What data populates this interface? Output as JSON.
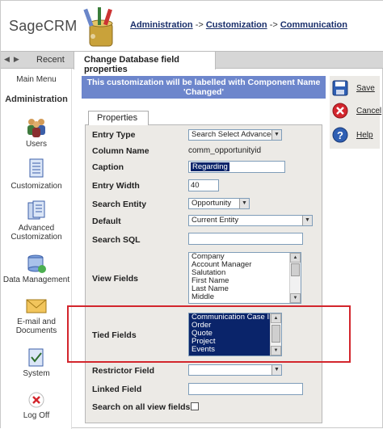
{
  "header": {
    "brand": "SageCRM",
    "breadcrumb": [
      "Administration",
      "Customization",
      "Communication"
    ],
    "separator": "->"
  },
  "tabs": {
    "recent": "Recent",
    "active": "Change Database field properties"
  },
  "sidebar": {
    "main_menu": "Main Menu",
    "section": "Administration",
    "items": [
      {
        "label": "Users",
        "icon": "users-icon"
      },
      {
        "label": "Customization",
        "icon": "customization-icon"
      },
      {
        "label_line1": "Advanced",
        "label_line2": "Customization",
        "icon": "advanced-customization-icon"
      },
      {
        "label": "Data Management",
        "icon": "data-management-icon"
      },
      {
        "label_line1": "E-mail and",
        "label_line2": "Documents",
        "icon": "email-icon"
      },
      {
        "label": "System",
        "icon": "system-icon"
      },
      {
        "label": "Log Off",
        "icon": "log-off-icon"
      }
    ]
  },
  "banner": {
    "line1": "This customization will be labelled with Component Name",
    "line2": "'Changed'"
  },
  "properties": {
    "tab": "Properties",
    "entry_type": {
      "label": "Entry Type",
      "value": "Search Select Advanced"
    },
    "column_name": {
      "label": "Column Name",
      "value": "comm_opportunityid"
    },
    "caption": {
      "label": "Caption",
      "value": "Regarding"
    },
    "entry_width": {
      "label": "Entry Width",
      "value": "40"
    },
    "search_entity": {
      "label": "Search Entity",
      "value": "Opportunity"
    },
    "default": {
      "label": "Default",
      "value": "Current Entity"
    },
    "search_sql": {
      "label": "Search SQL",
      "value": ""
    },
    "view_fields": {
      "label": "View Fields",
      "options": [
        "Company",
        "Account Manager",
        "Salutation",
        "First Name",
        "Last Name",
        "Middle"
      ]
    },
    "tied_fields": {
      "label": "Tied Fields",
      "options": [
        "Communication Case ID",
        "Order",
        "Quote",
        "Project",
        "Events"
      ]
    },
    "restrictor_field": {
      "label": "Restrictor Field",
      "value": ""
    },
    "linked_field": {
      "label": "Linked Field",
      "value": ""
    },
    "search_all_views": {
      "label": "Search on all view fields",
      "checked": false
    }
  },
  "actions": {
    "save": "Save",
    "cancel": "Cancel",
    "help": "Help"
  },
  "colors": {
    "banner": "#6d86cc",
    "highlight": "#0a246a",
    "callout": "#d3262d"
  }
}
